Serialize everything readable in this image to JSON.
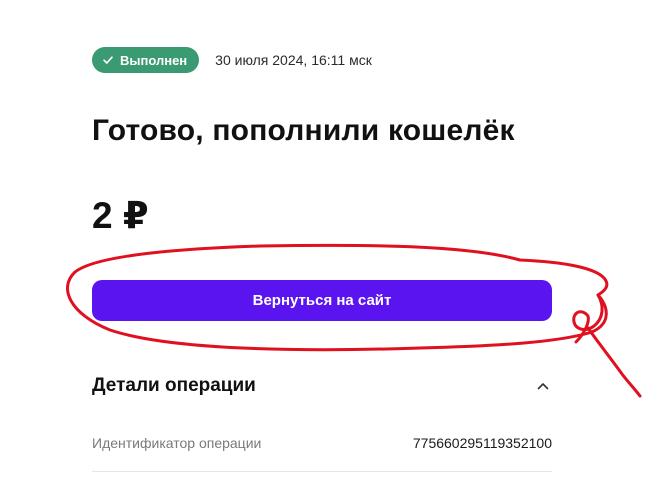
{
  "status": {
    "badge_label": "Выполнен",
    "badge_color": "#3a9a72",
    "timestamp": "30 июля 2024, 16:11 мск"
  },
  "title": "Готово, пополнили кошелёк",
  "amount": "2 ₽",
  "return_button": {
    "label": "Вернуться на сайт",
    "color": "#5a14f0"
  },
  "details": {
    "section_title": "Детали операции",
    "expanded": true,
    "rows": [
      {
        "label": "Идентификатор операции",
        "value": "775660295119352100"
      }
    ]
  },
  "annotation": {
    "color": "#e01020"
  }
}
